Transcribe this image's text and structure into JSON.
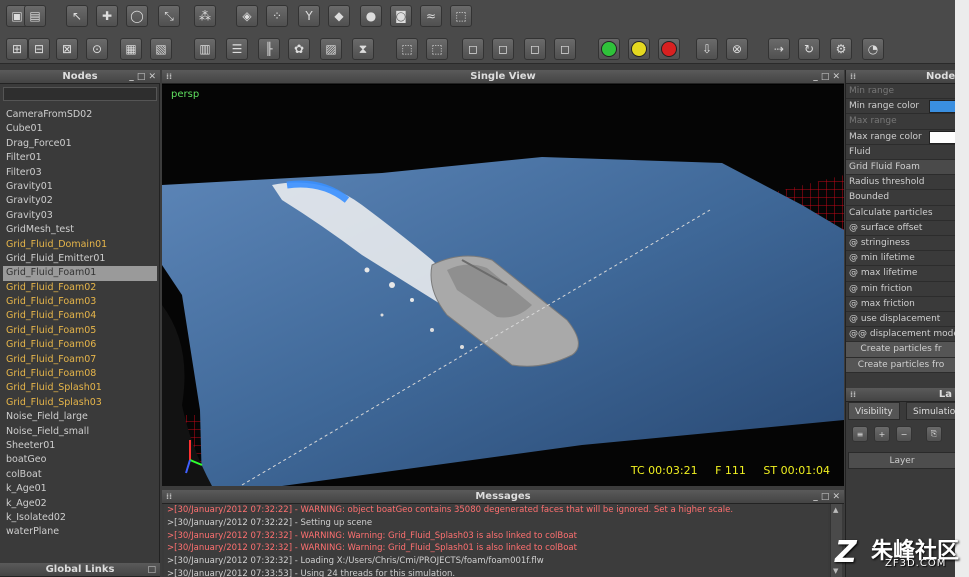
{
  "nodes_panel": {
    "title": "Nodes",
    "items": [
      "CameraFromSD02",
      "Cube01",
      "Drag_Force01",
      "Filter01",
      "Filter03",
      "Gravity01",
      "Gravity02",
      "Gravity03",
      "GridMesh_test",
      "Grid_Fluid_Domain01",
      "Grid_Fluid_Emitter01",
      "Grid_Fluid_Foam01",
      "Grid_Fluid_Foam02",
      "Grid_Fluid_Foam03",
      "Grid_Fluid_Foam04",
      "Grid_Fluid_Foam05",
      "Grid_Fluid_Foam06",
      "Grid_Fluid_Foam07",
      "Grid_Fluid_Foam08",
      "Grid_Fluid_Splash01",
      "Grid_Fluid_Splash03",
      "Noise_Field_large",
      "Noise_Field_small",
      "Sheeter01",
      "boatGeo",
      "colBoat",
      "k_Age01",
      "k_Age02",
      "k_Isolated02",
      "waterPlane"
    ],
    "highlighted": [
      "Grid_Fluid_Domain01",
      "Grid_Fluid_Foam02",
      "Grid_Fluid_Foam03",
      "Grid_Fluid_Foam04",
      "Grid_Fluid_Foam05",
      "Grid_Fluid_Foam06",
      "Grid_Fluid_Foam07",
      "Grid_Fluid_Foam08",
      "Grid_Fluid_Splash01",
      "Grid_Fluid_Splash03"
    ],
    "selected": "Grid_Fluid_Foam01"
  },
  "global_links": {
    "title": "Global Links"
  },
  "viewport": {
    "title": "Single View",
    "camera_label": "persp",
    "tc": "TC 00:03:21",
    "frame": "F 111",
    "st": "ST 00:01:04"
  },
  "messages": {
    "title": "Messages",
    "lines": [
      {
        "text": ">[30/January/2012 07:32:22] - WARNING: object boatGeo contains 35080 degenerated faces that will be ignored. Set a higher scale.",
        "type": "warn"
      },
      {
        "text": ">[30/January/2012 07:32:22] - Setting up scene",
        "type": "info"
      },
      {
        "text": ">[30/January/2012 07:32:32] - WARNING:  Warning: Grid_Fluid_Splash03 is also linked to colBoat",
        "type": "warn"
      },
      {
        "text": ">[30/January/2012 07:32:32] - WARNING:  Warning: Grid_Fluid_Splash01 is also linked to colBoat",
        "type": "warn"
      },
      {
        "text": ">[30/January/2012 07:32:32] -  Loading X:/Users/Chris/Cmi/PROJECTS/foam/foam001f.flw",
        "type": "info"
      },
      {
        "text": ">[30/January/2012 07:33:53] - Using 24 threads for this simulation.",
        "type": "info"
      }
    ]
  },
  "properties": {
    "title": "Node",
    "rows": [
      {
        "label": "Min range",
        "style": "dim"
      },
      {
        "label": "Min range color",
        "swatch": "#3a8fe0"
      },
      {
        "label": "Max range",
        "style": "dim"
      },
      {
        "label": "Max range color",
        "swatch": "#ffffff"
      },
      {
        "label": "Fluid",
        "style": ""
      },
      {
        "label": "Grid Fluid Foam",
        "style": "sec"
      },
      {
        "label": "Radius threshold",
        "style": ""
      },
      {
        "label": "Bounded",
        "style": ""
      },
      {
        "label": "Calculate particles",
        "style": ""
      },
      {
        "label": "@ surface offset",
        "style": ""
      },
      {
        "label": "@ stringiness",
        "style": ""
      },
      {
        "label": "@ min lifetime",
        "style": ""
      },
      {
        "label": "@ max lifetime",
        "style": ""
      },
      {
        "label": "@ min friction",
        "style": ""
      },
      {
        "label": "@ max friction",
        "style": ""
      },
      {
        "label": "@ use displacement",
        "style": ""
      },
      {
        "label": "@@ displacement mode",
        "style": ""
      },
      {
        "label": "Create particles fr",
        "style": "btn"
      },
      {
        "label": "Create particles fro",
        "style": "btn"
      }
    ]
  },
  "layers_panel": {
    "title": "La",
    "tab_visibility": "Visibility",
    "tab_simulation": "Simulation",
    "column_layer": "Layer"
  },
  "watermark": {
    "text_cn": "朱峰社区",
    "text_en": "ZF3D.COM"
  },
  "colors": {
    "accent_orange": "#e6b54a",
    "warning": "#ff7070",
    "hud_yellow": "#f0f020",
    "persp_green": "#5fe05f"
  }
}
